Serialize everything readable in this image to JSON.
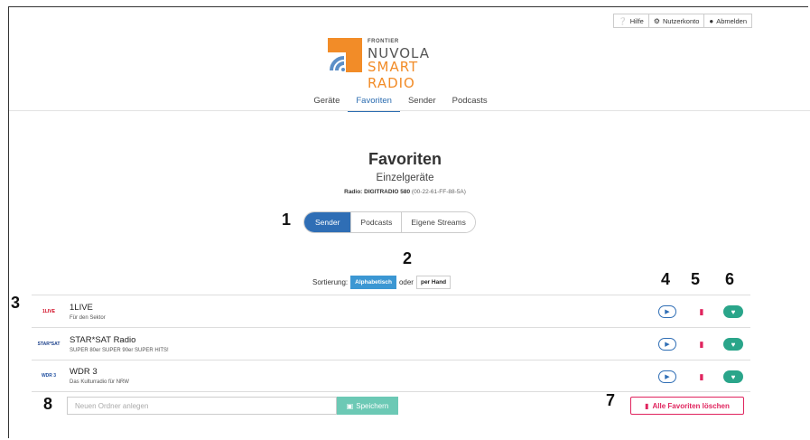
{
  "topbar": {
    "help": "Hilfe",
    "account": "Nutzerkonto",
    "logout": "Abmelden"
  },
  "logo": {
    "small": "FRONTIER",
    "line1": "NUVOLA",
    "line2": "SMART RADIO"
  },
  "nav": {
    "tabs": [
      "Geräte",
      "Favoriten",
      "Sender",
      "Podcasts"
    ],
    "active": "Favoriten"
  },
  "page": {
    "title": "Favoriten",
    "subtitle": "Einzelgeräte",
    "radio_label": "Radio: DIGITRADIO 580",
    "radio_mac": "(00-22-61-FF-88-5A)"
  },
  "segments": [
    "Sender",
    "Podcasts",
    "Eigene Streams"
  ],
  "sort": {
    "label": "Sortierung:",
    "alpha": "Alphabetisch",
    "or": "oder",
    "manual": "per Hand"
  },
  "stations": [
    {
      "logo": "1LIVE",
      "name": "1LIVE",
      "desc": "Für den Sektor"
    },
    {
      "logo": "STAR*SAT",
      "name": "STAR*SAT Radio",
      "desc": "SUPER 80er SUPER 90er SUPER HITS!"
    },
    {
      "logo": "WDR 3",
      "name": "WDR 3",
      "desc": "Das Kulturradio für NRW"
    }
  ],
  "folder": {
    "placeholder": "Neuen Ordner anlegen",
    "save": "Speichern"
  },
  "delete_all": "Alle Favoriten löschen",
  "annotations": [
    "1",
    "2",
    "3",
    "4",
    "5",
    "6",
    "7",
    "8"
  ],
  "colors": {
    "primary": "#2f6eb5",
    "accent_orange": "#f28c28",
    "danger": "#e0245e",
    "favorite": "#2aa58a"
  }
}
